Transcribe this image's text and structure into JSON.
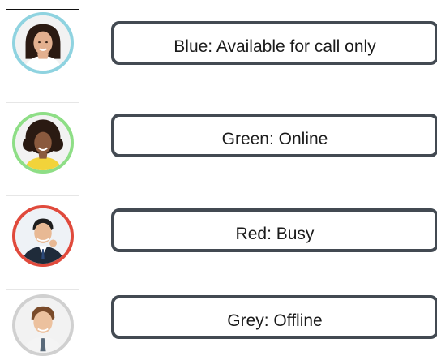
{
  "statuses": [
    {
      "label": "Blue: Available for call only",
      "ring_color": "#8fd3e0",
      "avatar": "woman-avatar"
    },
    {
      "label": "Green: Online",
      "ring_color": "#8ede86",
      "avatar": "woman-curly-avatar"
    },
    {
      "label": "Red: Busy",
      "ring_color": "#e04a3c",
      "avatar": "man-suit-avatar"
    },
    {
      "label": "Grey: Offline",
      "ring_color": "#d0d0d0",
      "avatar": "man-tie-avatar"
    }
  ]
}
